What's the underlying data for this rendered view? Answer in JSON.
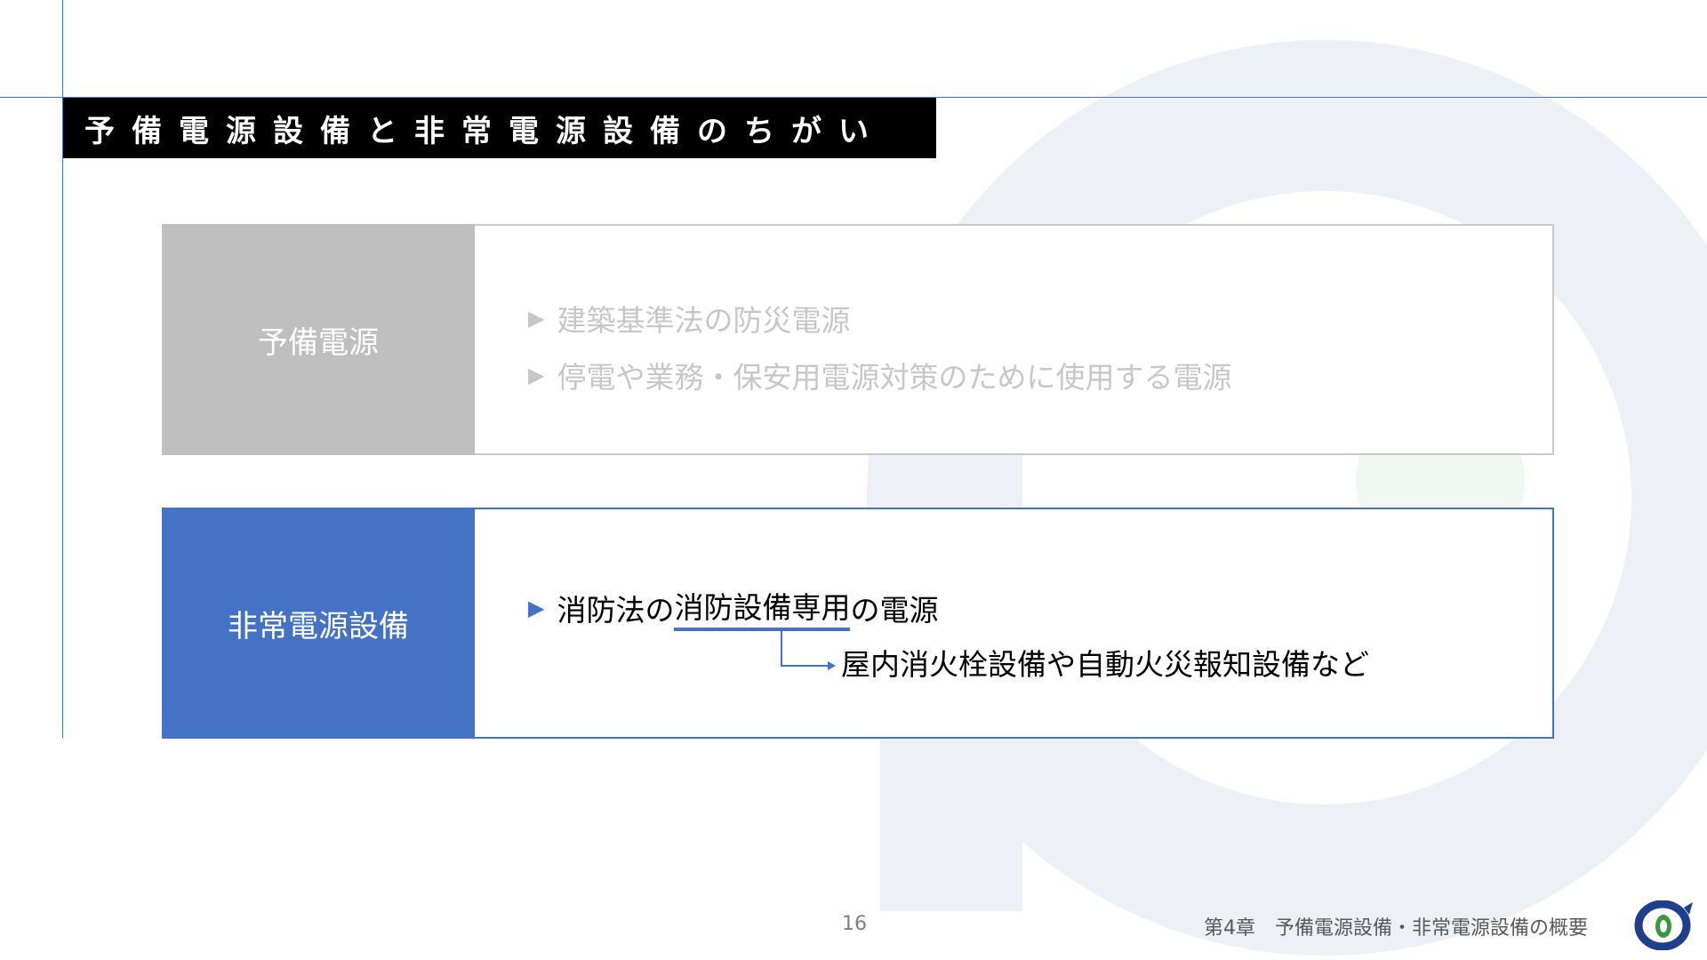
{
  "slide": {
    "title": "予備電源設備と非常電源設備のちがい",
    "page_number": "16",
    "footer_title": "第4章　予備電源設備・非常電源設備の概要"
  },
  "rows": [
    {
      "label": "予備電源",
      "bullets": [
        "建築基準法の防災電源",
        "停電や業務・保安用電源対策のために使用する電源"
      ]
    },
    {
      "label": "非常電源設備",
      "bullet_prefix": "消防法の",
      "bullet_highlight": "消防設備専用",
      "bullet_suffix": "の電源",
      "sub_note": "屋内消火栓設備や自動火災報知設備など"
    }
  ],
  "icons": {
    "bullet": "triangle-right-icon",
    "logo": "company-logo"
  },
  "colors": {
    "accent": "#4472c4",
    "muted": "#bfbfbf",
    "title_bg": "#000000",
    "watermark": "#eef0f7"
  }
}
